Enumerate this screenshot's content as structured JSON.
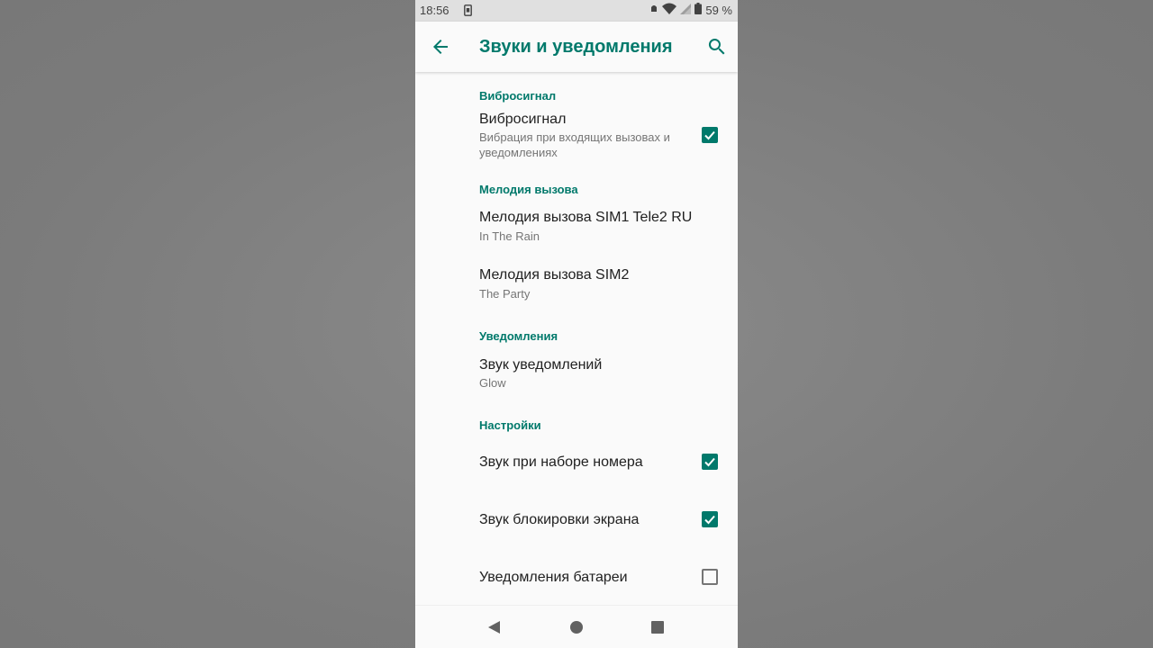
{
  "status_bar": {
    "time": "18:56",
    "battery_percent": "59 %",
    "icons": [
      "sim-card-icon",
      "alarm-icon",
      "wifi-icon",
      "signal-icon",
      "battery-icon"
    ]
  },
  "app_bar": {
    "title": "Звуки и уведомления",
    "back_icon": "arrow-left-icon",
    "search_icon": "search-icon"
  },
  "sections": {
    "vibration": {
      "header": "Вибросигнал",
      "item_title": "Вибросигнал",
      "item_sub": "Вибрация при входящих вызовах и уведомлениях",
      "checked": true
    },
    "ringtone": {
      "header": "Мелодия вызова",
      "sim1_title": "Мелодия вызова SIM1 Tele2 RU",
      "sim1_value": "In The Rain",
      "sim2_title": "Мелодия вызова SIM2",
      "sim2_value": "The Party"
    },
    "notifications": {
      "header": "Уведомления",
      "sound_title": "Звук уведомлений",
      "sound_value": "Glow"
    },
    "settings": {
      "header": "Настройки",
      "dial_title": "Звук при наборе номера",
      "dial_checked": true,
      "lock_title": "Звук блокировки экрана",
      "lock_checked": true,
      "battery_title": "Уведомления батареи",
      "battery_checked": false
    }
  },
  "colors": {
    "accent": "#00796b",
    "primary_text": "#212121",
    "secondary_text": "#757575",
    "background": "#fafafa",
    "status_bar": "#e0e0e0"
  },
  "nav_bar": {
    "icons": [
      "nav-back-icon",
      "nav-home-icon",
      "nav-recents-icon"
    ]
  }
}
